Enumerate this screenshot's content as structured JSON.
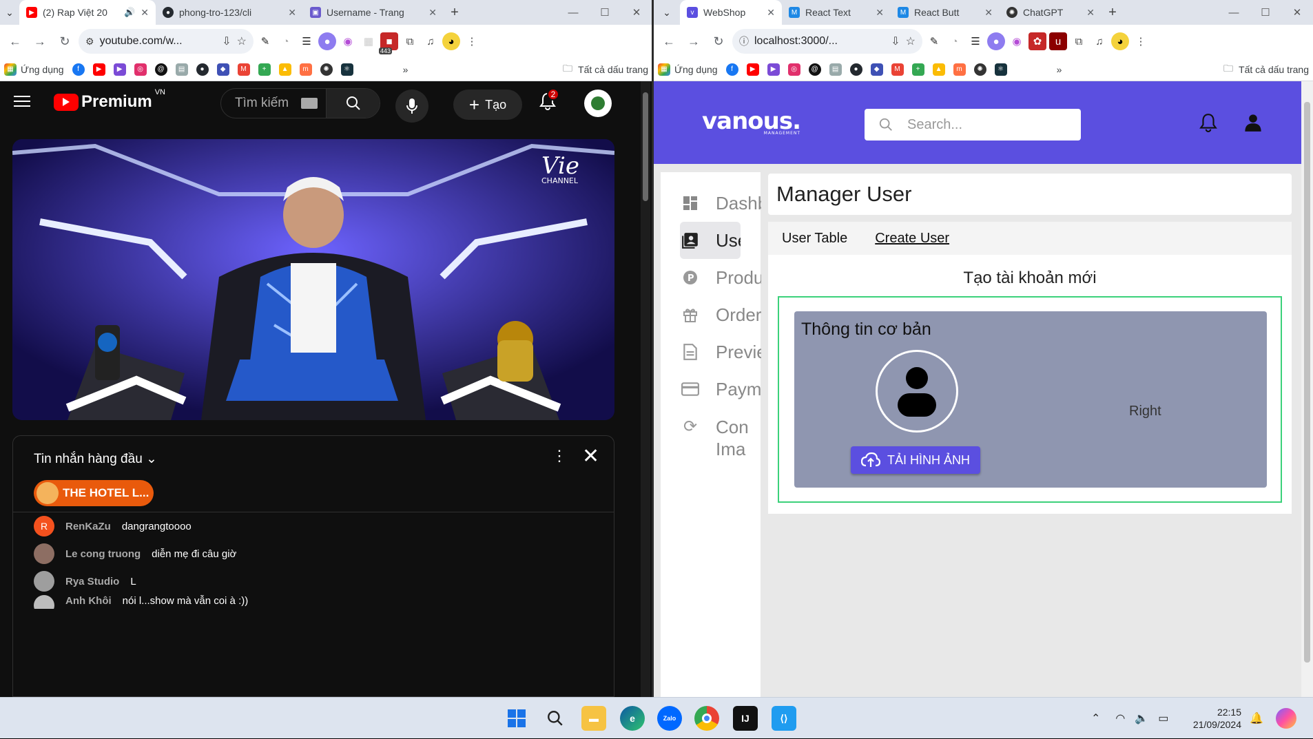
{
  "left_window": {
    "tabs": [
      {
        "title": "(2) Rap Việt 20",
        "active": true
      },
      {
        "title": "phong-tro-123/cli",
        "active": false
      },
      {
        "title": "Username - Trang",
        "active": false
      }
    ],
    "url": "youtube.com/w...",
    "ext_badge": "443",
    "bookmarks": {
      "apps_label": "Ứng dụng",
      "all_label": "Tất cả dấu trang",
      "more": "»"
    }
  },
  "youtube": {
    "logo_text": "Premium",
    "region": "VN",
    "search_placeholder": "Tìm kiếm",
    "create_label": "Tạo",
    "notif_count": "2",
    "video_watermark_line1": "Vie",
    "video_watermark_line2": "CHANNEL",
    "chat": {
      "title": "Tin nhắn hàng đầu",
      "pinned": "THE HOTEL L...",
      "messages": [
        {
          "initial": "R",
          "author": "RenKaZu",
          "text": "dangrangtoooo",
          "color": "#f4511e"
        },
        {
          "initial": "",
          "author": "Le cong truong",
          "text": "diễn mẹ đi câu giờ",
          "color": "#8d6e63"
        },
        {
          "initial": "",
          "author": "Rya Studio",
          "text": "L",
          "color": "#9e9e9e"
        },
        {
          "initial": "",
          "author": "Anh Khôi",
          "text": "nói l...show mà vẫn coi à :))",
          "color": "#bdbdbd"
        }
      ]
    }
  },
  "right_window": {
    "tabs": [
      {
        "title": "WebShop",
        "active": true
      },
      {
        "title": "React Text",
        "active": false
      },
      {
        "title": "React Butt",
        "active": false
      },
      {
        "title": "ChatGPT",
        "active": false
      }
    ],
    "url": "localhost:3000/...",
    "bookmarks": {
      "apps_label": "Ứng dụng",
      "all_label": "Tất cả dấu trang",
      "more": "»"
    }
  },
  "webshop": {
    "brand": "vanous.",
    "brand_sub": "MANAGEMENT",
    "search_placeholder": "Search...",
    "sidebar": [
      {
        "icon": "dashboard-icon",
        "label": "Dashboard",
        "active": false
      },
      {
        "icon": "user-card-icon",
        "label": "User",
        "active": true
      },
      {
        "icon": "product-icon",
        "label": "Product",
        "active": false
      },
      {
        "icon": "gift-icon",
        "label": "Order",
        "active": false
      },
      {
        "icon": "document-icon",
        "label": "Preview",
        "active": false
      },
      {
        "icon": "card-icon",
        "label": "Payment",
        "active": false
      },
      {
        "icon": "sync-icon",
        "label": "Con",
        "label2": "Ima",
        "active": false
      }
    ],
    "page_title": "Manager User",
    "tabs": {
      "user_table": "User Table",
      "create_user": "Create User"
    },
    "form_title": "Tạo tài khoản mới",
    "section_title": "Thông tin cơ bản",
    "upload_label": "TẢI HÌNH ẢNH",
    "right_placeholder": "Right"
  },
  "taskbar": {
    "time": "22:15",
    "date": "21/09/2024"
  },
  "colors": {
    "youtube_red": "#ff0000",
    "webshop_primary": "#5b4fe0",
    "form_border": "#3bd17a",
    "form_panel": "#8f96b0"
  }
}
